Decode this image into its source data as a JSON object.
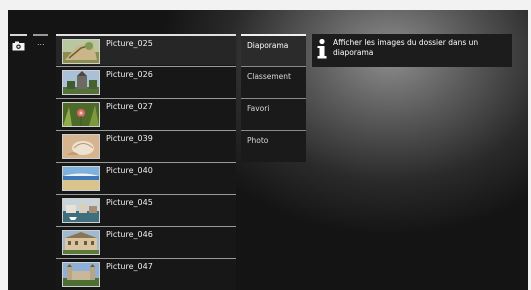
{
  "source": {
    "more_label": "..."
  },
  "pictures": [
    {
      "label": "Picture_025",
      "thumb_icon": "orchard-thumbnail"
    },
    {
      "label": "Picture_026",
      "thumb_icon": "church-thumbnail"
    },
    {
      "label": "Picture_027",
      "thumb_icon": "flower-thumbnail"
    },
    {
      "label": "Picture_039",
      "thumb_icon": "shell-thumbnail"
    },
    {
      "label": "Picture_040",
      "thumb_icon": "beach-thumbnail"
    },
    {
      "label": "Picture_045",
      "thumb_icon": "harbor-thumbnail"
    },
    {
      "label": "Picture_046",
      "thumb_icon": "building-thumbnail"
    },
    {
      "label": "Picture_047",
      "thumb_icon": "castle-thumbnail"
    }
  ],
  "menu": {
    "items": [
      {
        "label": "Diaporama",
        "active": true
      },
      {
        "label": "Classement",
        "active": false
      },
      {
        "label": "Favori",
        "active": false
      },
      {
        "label": "Photo",
        "active": false
      }
    ]
  },
  "info": {
    "icon": "info-icon",
    "text": "Afficher les images du dossier dans un diaporama"
  },
  "colors": {
    "background": "#0c0c0c",
    "frame": "#f2f2f2",
    "highlight_line": "#f0f0f0"
  }
}
